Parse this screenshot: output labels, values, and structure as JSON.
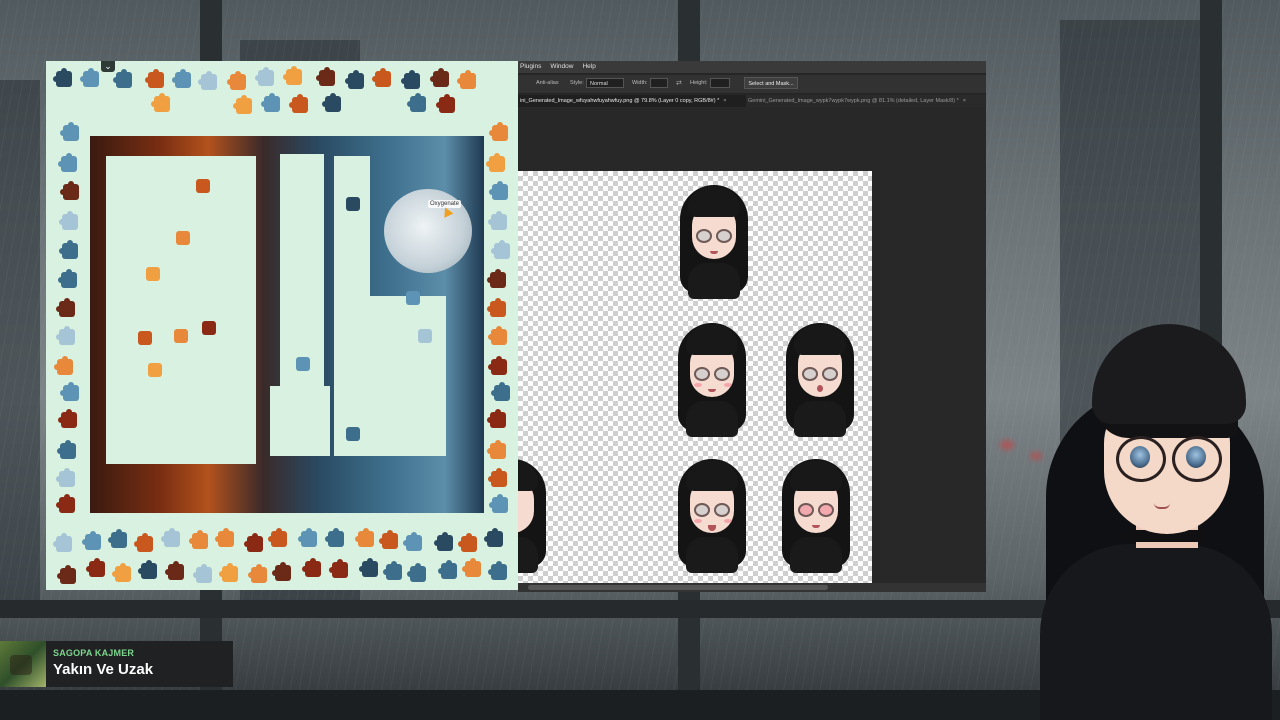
{
  "puzzle": {
    "tooltip": "Oxygenate",
    "collapse_icon": "chevron-double-down-icon",
    "colors": {
      "background": "#d9f1e1",
      "fire": "#c9581e",
      "water": "#3d6f8c"
    }
  },
  "photoshop": {
    "menu": [
      "Plugins",
      "Window",
      "Help"
    ],
    "options": {
      "anti_alias_label": "Anti-alias",
      "style_label": "Style:",
      "style_value": "Normal",
      "width_label": "Width:",
      "height_label": "Height:",
      "select_mask_label": "Select and Mask..."
    },
    "tabs": [
      {
        "label": "ini_Generated_Image_wfuyahwfuyahwfuy.png @ 79.8% (Layer 0 copy, RGB/8#) *",
        "active": true
      },
      {
        "label": "Gemini_Generated_Image_wypk7wypk7wypk.png @ 81.1% (detailed, Layer Mask/8) *",
        "active": false
      }
    ]
  },
  "now_playing": {
    "artist": "SAGOPA KAJMER",
    "title": "Yakın Ve Uzak"
  }
}
